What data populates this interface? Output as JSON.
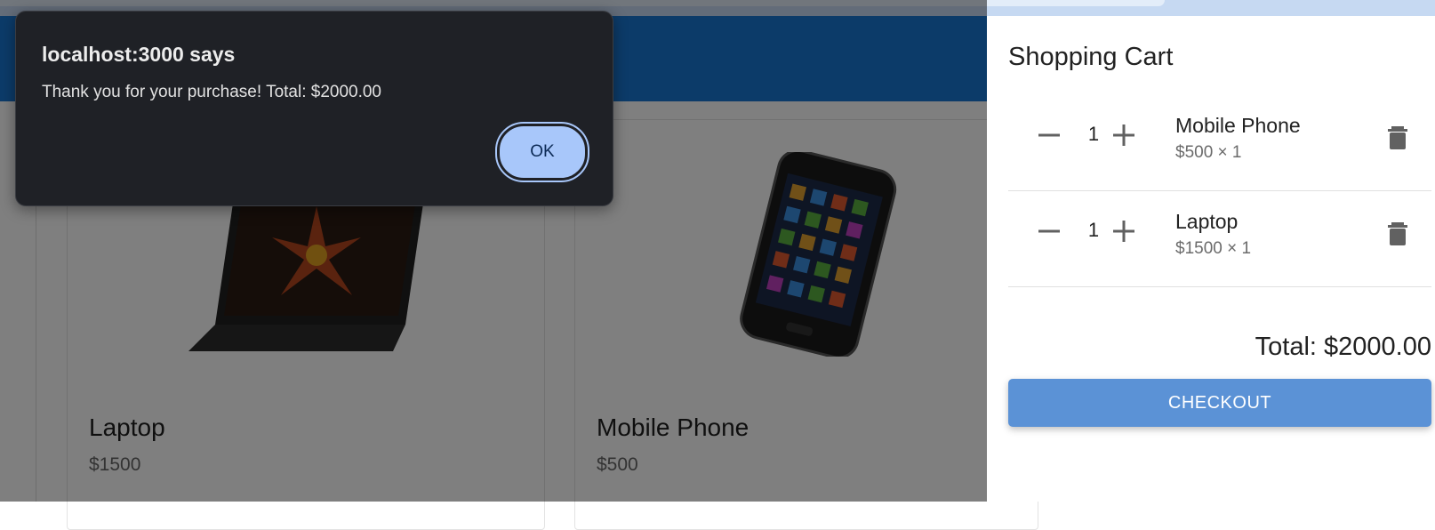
{
  "alert": {
    "title": "localhost:3000 says",
    "message": "Thank you for your purchase! Total: $2000.00",
    "ok_label": "OK"
  },
  "products": [
    {
      "name": "Laptop",
      "price": "$1500"
    },
    {
      "name": "Mobile Phone",
      "price": "$500"
    }
  ],
  "cart": {
    "title": "Shopping Cart",
    "items": [
      {
        "name": "Mobile Phone",
        "detail": "$500 × 1",
        "qty": "1"
      },
      {
        "name": "Laptop",
        "detail": "$1500 × 1",
        "qty": "1"
      }
    ],
    "total": "Total: $2000.00",
    "checkout_label": "CHECKOUT"
  },
  "colors": {
    "appbar": "#1976d2",
    "checkout": "#5b92d6",
    "alert_bg": "#1f2126",
    "alert_ok": "#a8c7fa"
  },
  "icons": [
    "minus-icon",
    "plus-icon",
    "trash-icon"
  ]
}
